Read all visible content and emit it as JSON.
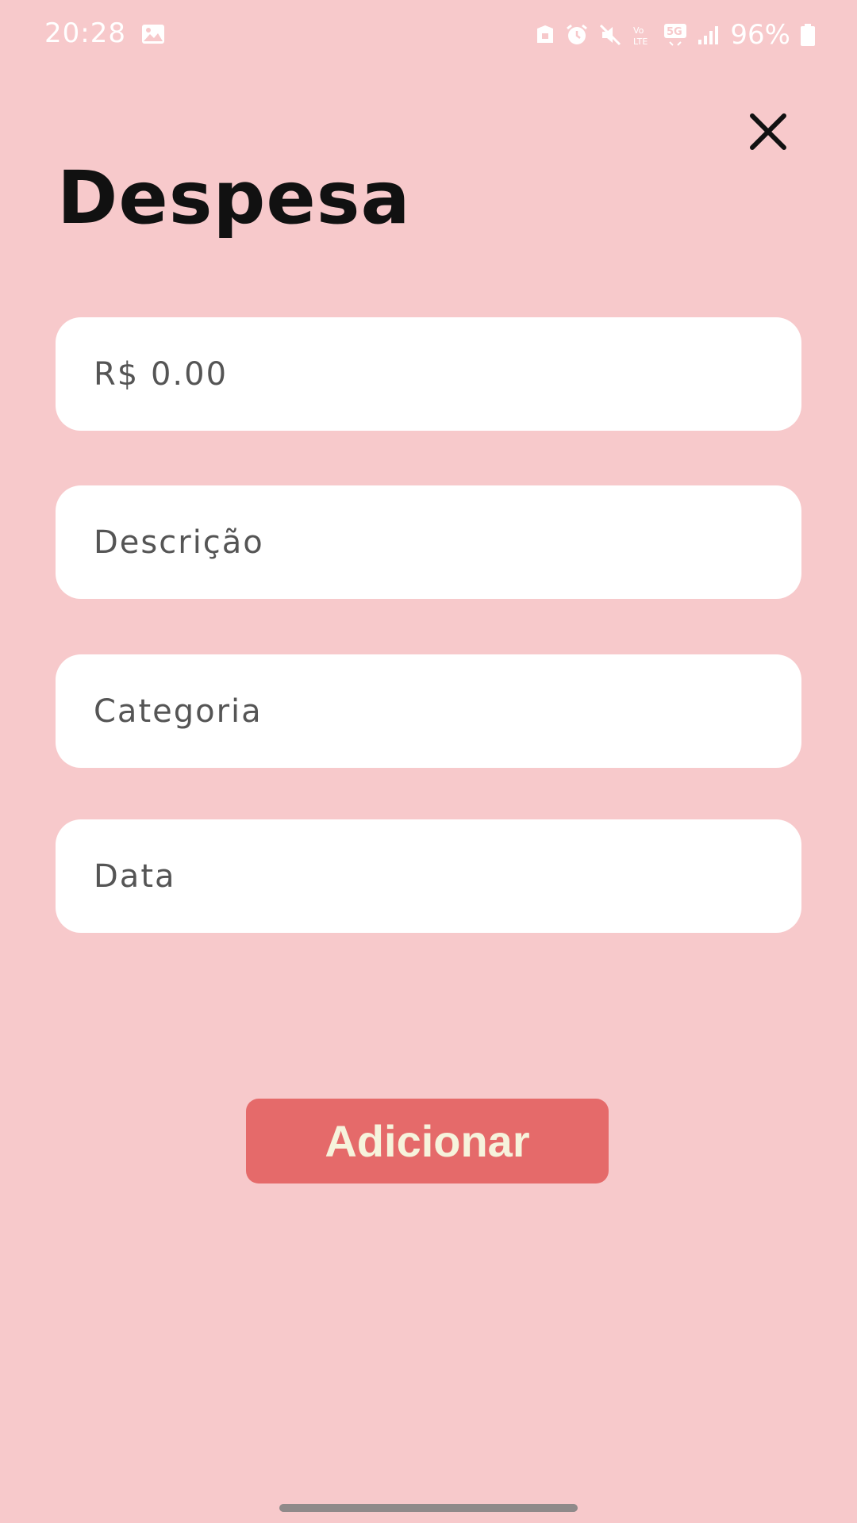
{
  "status_bar": {
    "time": "20:28",
    "battery": "96%",
    "icons": [
      "gallery-icon",
      "secure-folder-icon",
      "alarm-icon",
      "mute-icon",
      "volte-icon",
      "5g-icon",
      "signal-icon",
      "battery-icon"
    ]
  },
  "header": {
    "title": "Despesa",
    "close_icon": "close-icon"
  },
  "form": {
    "value": "R$ 0.00",
    "description_placeholder": "Descrição",
    "category_placeholder": "Categoria",
    "date_placeholder": "Data"
  },
  "actions": {
    "add_label": "Adicionar"
  },
  "colors": {
    "background": "#f7c9cb",
    "button": "#e56a6a",
    "button_text": "#f6f3dc",
    "field": "#ffffff"
  }
}
